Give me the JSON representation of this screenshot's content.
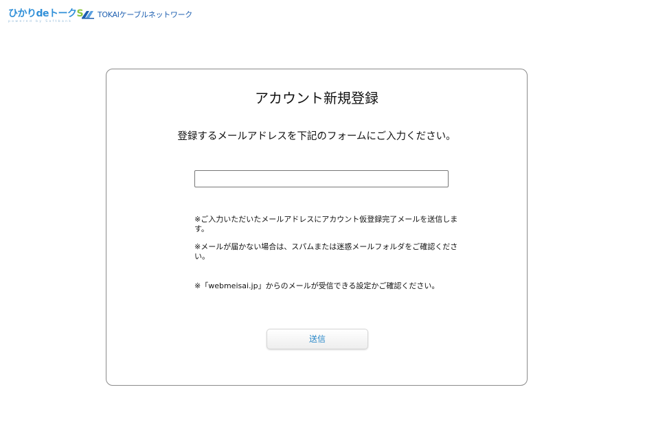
{
  "header": {
    "logo_main_prefix": "ひかりdeトーク",
    "logo_main_suffix": "S",
    "logo_sub": "powered by Softbank",
    "partner_logo": "TOKAIケーブルネットワーク"
  },
  "form": {
    "title": "アカウント新規登録",
    "instruction": "登録するメールアドレスを下記のフォームにご入力ください。",
    "email_value": "",
    "notes": [
      "※ご入力いただいたメールアドレスにアカウント仮登録完了メールを送信します。",
      "※メールが届かない場合は、スパムまたは迷惑メールフォルダをご確認ください。",
      "※「webmeisai.jp」からのメールが受信できる設定かご確認ください。"
    ],
    "submit_label": "送信"
  },
  "colors": {
    "brand_blue": "#2f8fd8",
    "brand_green": "#8cc63f",
    "tokai_blue": "#1d5fb0",
    "button_text": "#2a88c8"
  }
}
